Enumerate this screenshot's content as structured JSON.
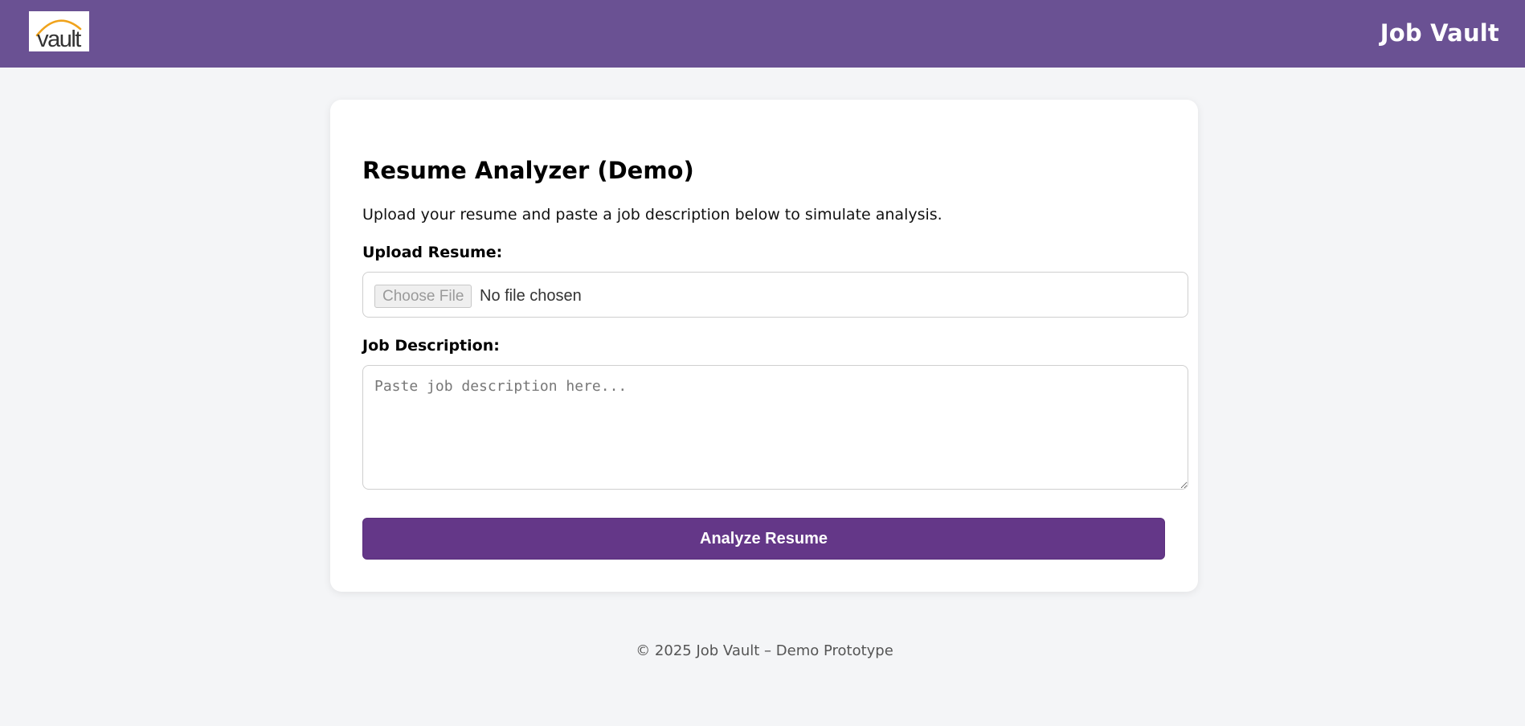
{
  "header": {
    "logo_text": "vault",
    "brand_title": "Job Vault"
  },
  "main": {
    "heading": "Resume Analyzer (Demo)",
    "intro": "Upload your resume and paste a job description below to simulate analysis.",
    "upload": {
      "label": "Upload Resume:",
      "button_label": "Choose File",
      "status": "No file chosen"
    },
    "job_description": {
      "label": "Job Description:",
      "placeholder": "Paste job description here...",
      "value": ""
    },
    "analyze_button_label": "Analyze Resume"
  },
  "footer": {
    "text": "© 2025 Job Vault – Demo Prototype"
  },
  "colors": {
    "header_bg": "#6a5193",
    "accent": "#643788",
    "page_bg": "#f4f5f7",
    "logo_arc": "#f0a31c"
  }
}
